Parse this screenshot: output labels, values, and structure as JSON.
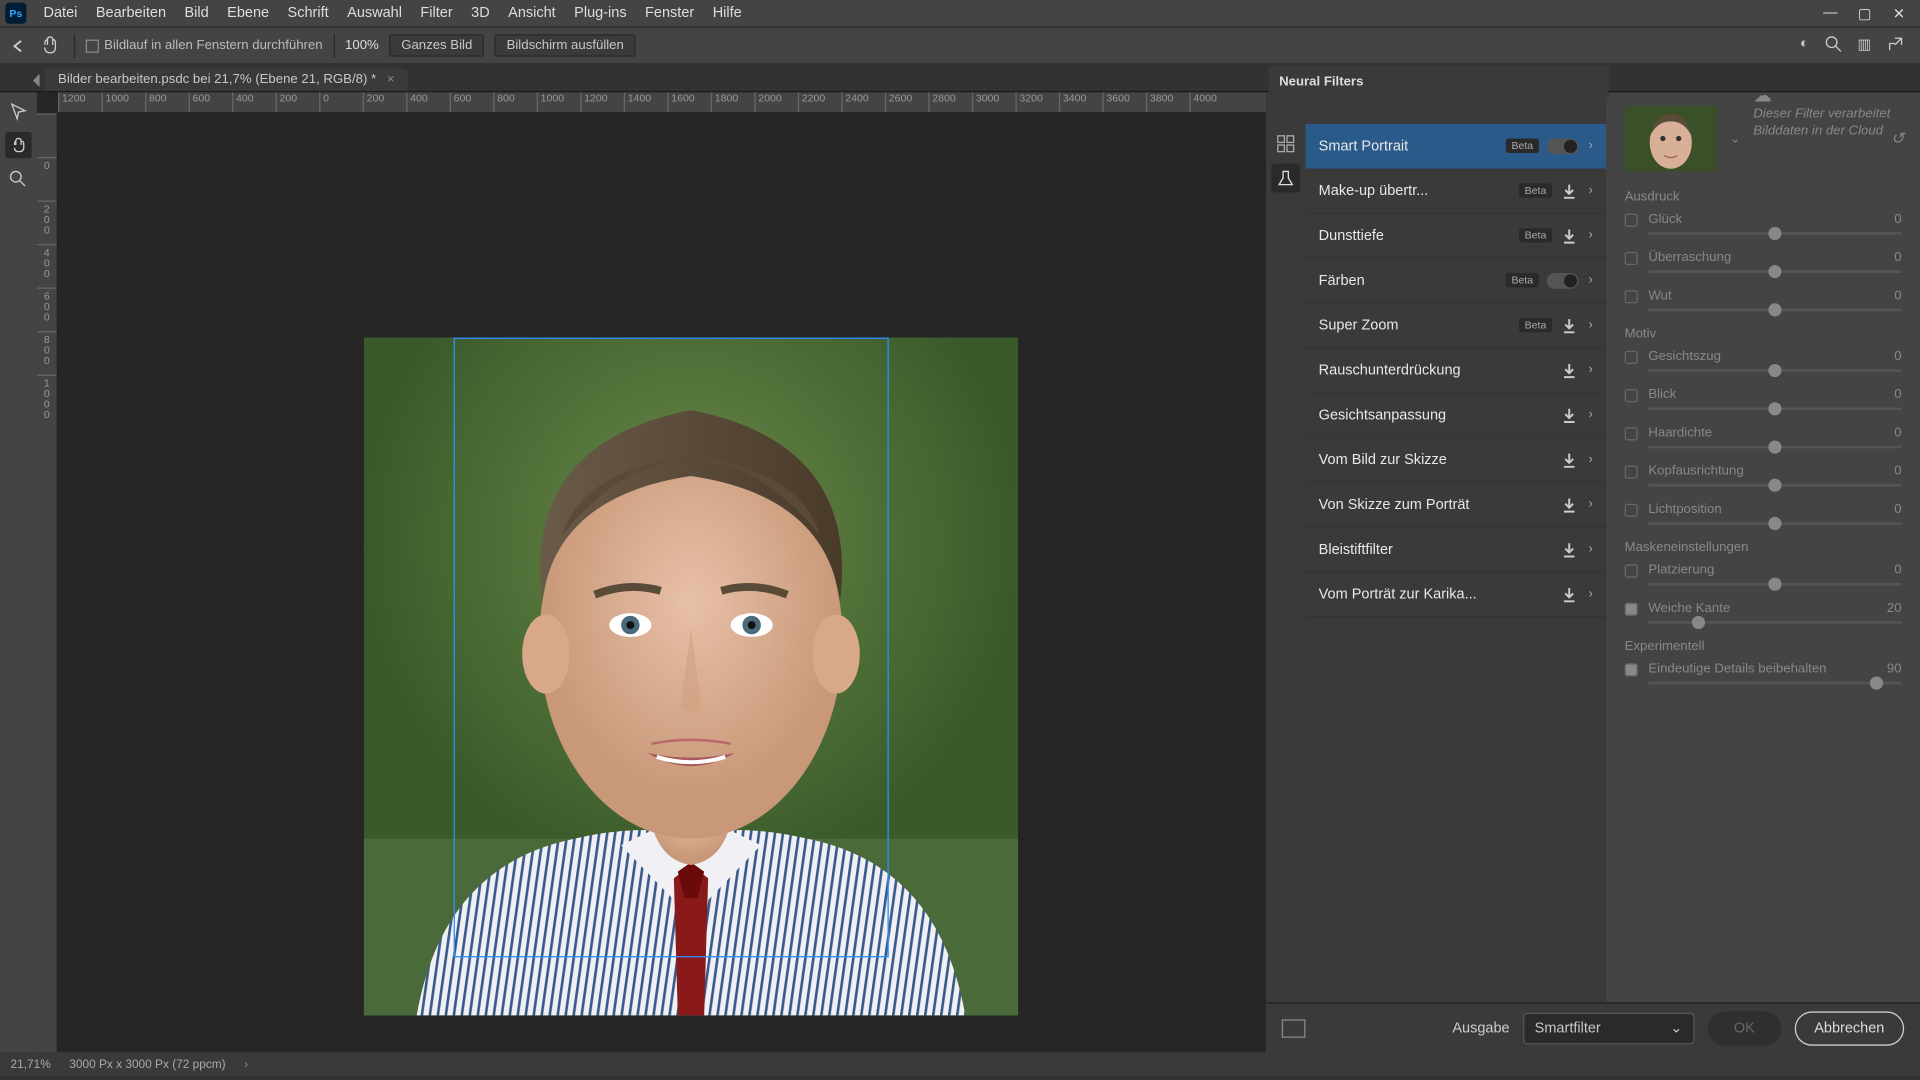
{
  "menubar": [
    "Datei",
    "Bearbeiten",
    "Bild",
    "Ebene",
    "Schrift",
    "Auswahl",
    "Filter",
    "3D",
    "Ansicht",
    "Plug-ins",
    "Fenster",
    "Hilfe"
  ],
  "optbar": {
    "scroll_all": "Bildlauf in allen Fenstern durchführen",
    "zoom": "100%",
    "fit": "Ganzes Bild",
    "fill": "Bildschirm ausfüllen"
  },
  "tab": {
    "title": "Bilder bearbeiten.psdc bei 21,7% (Ebene 21, RGB/8) *"
  },
  "hruler": [
    "1200",
    "1000",
    "800",
    "600",
    "400",
    "200",
    "0",
    "200",
    "400",
    "600",
    "800",
    "1000",
    "1200",
    "1400",
    "1600",
    "1800",
    "2000",
    "2200",
    "2400",
    "2600",
    "2800",
    "3000",
    "3200",
    "3400",
    "3600",
    "3800",
    "4000"
  ],
  "vruler": [
    "",
    "0",
    "2\n0\n0",
    "4\n0\n0",
    "6\n0\n0",
    "8\n0\n0",
    "1\n0\n0\n0"
  ],
  "panel_title": "Neural Filters",
  "filters": [
    {
      "name": "Smart Portrait",
      "badge": "Beta",
      "ctrl": "toggle",
      "selected": true
    },
    {
      "name": "Make-up übertr...",
      "badge": "Beta",
      "ctrl": "download"
    },
    {
      "name": "Dunsttiefe",
      "badge": "Beta",
      "ctrl": "download"
    },
    {
      "name": "Färben",
      "badge": "Beta",
      "ctrl": "toggle"
    },
    {
      "name": "Super Zoom",
      "badge": "Beta",
      "ctrl": "download"
    },
    {
      "name": "Rauschunterdrückung",
      "badge": "",
      "ctrl": "download"
    },
    {
      "name": "Gesichtsanpassung",
      "badge": "",
      "ctrl": "download"
    },
    {
      "name": "Vom Bild zur Skizze",
      "badge": "",
      "ctrl": "download"
    },
    {
      "name": "Von Skizze zum Porträt",
      "badge": "",
      "ctrl": "download"
    },
    {
      "name": "Bleistiftfilter",
      "badge": "",
      "ctrl": "download"
    },
    {
      "name": "Vom Porträt zur Karika...",
      "badge": "",
      "ctrl": "download"
    }
  ],
  "cloud_note": "Dieser Filter verarbeitet Bilddaten in der Cloud",
  "sections": {
    "ausdruck": "Ausdruck",
    "motiv": "Motiv",
    "masken": "Maskeneinstellungen",
    "exp": "Experimentell"
  },
  "sliders": [
    {
      "lbl": "Glück",
      "val": "0",
      "pos": 50,
      "on": false,
      "sec": "ausdruck"
    },
    {
      "lbl": "Überraschung",
      "val": "0",
      "pos": 50,
      "on": false,
      "sec": "ausdruck"
    },
    {
      "lbl": "Wut",
      "val": "0",
      "pos": 50,
      "on": false,
      "sec": "ausdruck"
    },
    {
      "lbl": "Gesichtszug",
      "val": "0",
      "pos": 50,
      "on": false,
      "sec": "motiv"
    },
    {
      "lbl": "Blick",
      "val": "0",
      "pos": 50,
      "on": false,
      "sec": "motiv"
    },
    {
      "lbl": "Haardichte",
      "val": "0",
      "pos": 50,
      "on": false,
      "sec": "motiv"
    },
    {
      "lbl": "Kopfausrichtung",
      "val": "0",
      "pos": 50,
      "on": false,
      "sec": "motiv"
    },
    {
      "lbl": "Lichtposition",
      "val": "0",
      "pos": 50,
      "on": false,
      "sec": "motiv"
    },
    {
      "lbl": "Platzierung",
      "val": "0",
      "pos": 50,
      "on": false,
      "sec": "masken"
    },
    {
      "lbl": "Weiche Kante",
      "val": "20",
      "pos": 20,
      "on": true,
      "sec": "masken"
    },
    {
      "lbl": "Eindeutige Details beibehalten",
      "val": "90",
      "pos": 90,
      "on": true,
      "sec": "exp"
    }
  ],
  "bottom": {
    "ausgabe": "Ausgabe",
    "select_val": "Smartfilter",
    "ok": "OK",
    "cancel": "Abbrechen"
  },
  "status": {
    "zoom": "21,71%",
    "dims": "3000 Px x 3000 Px (72 ppcm)"
  }
}
